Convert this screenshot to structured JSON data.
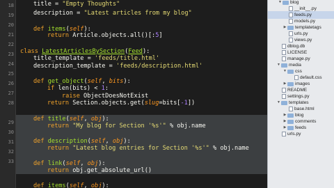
{
  "editor": {
    "line_numbers": [
      "18",
      "19",
      "20",
      "21",
      "22",
      "23",
      "24",
      "25",
      "26",
      "27",
      "28",
      "29",
      "30",
      "31",
      "32",
      "33"
    ],
    "code": {
      "l1": [
        "title",
        " = ",
        "\"Empty Thoughts\""
      ],
      "l2": [
        "description",
        " = ",
        "\"Latest articles from my blog\""
      ],
      "l3": [
        "def",
        " ",
        "items",
        "(",
        "self",
        "):"
      ],
      "l4": [
        "return",
        " Article.objects.all()[:",
        "5",
        "]"
      ],
      "l5": [
        "class",
        " ",
        "LatestArticlesBySection",
        "(",
        "Feed",
        "):"
      ],
      "l6": [
        "title_template",
        " = ",
        "'feeds/title.html'"
      ],
      "l7": [
        "description_template",
        " = ",
        "'feeds/description.html'"
      ],
      "l8": [
        "def",
        " ",
        "get_object",
        "(",
        "self",
        ", ",
        "bits",
        "):"
      ],
      "l9": [
        "if",
        " len(bits) < ",
        "1",
        ":"
      ],
      "l10": [
        "raise",
        " ObjectDoesNotExist"
      ],
      "l11": [
        "return",
        " Section.objects.get(",
        "slug",
        "=bits[",
        "-1",
        "])"
      ],
      "l12": [
        "def",
        " ",
        "title",
        "(",
        "self",
        ", ",
        "obj",
        "):"
      ],
      "l13": [
        "return",
        " ",
        "\"My blog for Section '%s'\"",
        " % obj.name"
      ],
      "l14": [
        "def",
        " ",
        "description",
        "(",
        "self",
        ", ",
        "obj",
        "):"
      ],
      "l15": [
        "return",
        " ",
        "\"Latest blog entries for Section '%s'\"",
        " % obj.name"
      ],
      "l16": [
        "def",
        " ",
        "link",
        "(",
        "self",
        ", ",
        "obj",
        "):"
      ],
      "l17": [
        "return",
        " obj.get_absolute_url()"
      ],
      "l18": [
        "def",
        " ",
        "items",
        "(",
        "self",
        ", ",
        "obj",
        "):"
      ]
    }
  },
  "file_tree": {
    "items": [
      {
        "label": "blog",
        "kind": "folder",
        "expanded": true
      },
      {
        "label": "__init__.py",
        "kind": "file"
      },
      {
        "label": "feeds.py",
        "kind": "file",
        "selected": true
      },
      {
        "label": "models.py",
        "kind": "file"
      },
      {
        "label": "templatetags",
        "kind": "folder",
        "expanded": false
      },
      {
        "label": "urls.py",
        "kind": "file"
      },
      {
        "label": "views.py",
        "kind": "file"
      },
      {
        "label": "dblog.db",
        "kind": "file"
      },
      {
        "label": "LICENSE",
        "kind": "file"
      },
      {
        "label": "manage.py",
        "kind": "file"
      },
      {
        "label": "media",
        "kind": "folder",
        "expanded": true
      },
      {
        "label": "css",
        "kind": "folder",
        "expanded": true
      },
      {
        "label": "default.css",
        "kind": "file"
      },
      {
        "label": "images",
        "kind": "folder",
        "expanded": false
      },
      {
        "label": "README",
        "kind": "file"
      },
      {
        "label": "settings.py",
        "kind": "file"
      },
      {
        "label": "templates",
        "kind": "folder",
        "expanded": true
      },
      {
        "label": "base.html",
        "kind": "file"
      },
      {
        "label": "blog",
        "kind": "folder",
        "expanded": false
      },
      {
        "label": "comments",
        "kind": "folder",
        "expanded": false
      },
      {
        "label": "feeds",
        "kind": "folder",
        "expanded": false
      },
      {
        "label": "urls.py",
        "kind": "file"
      }
    ]
  },
  "colors": {
    "editor_bg": "#1d1d1d",
    "keyword": "#f2a32a",
    "function": "#a6e22e",
    "string": "#e6db74",
    "number": "#ae81ff",
    "selection": "#3c3f41",
    "sidebar_bg": "#e8eaed"
  }
}
